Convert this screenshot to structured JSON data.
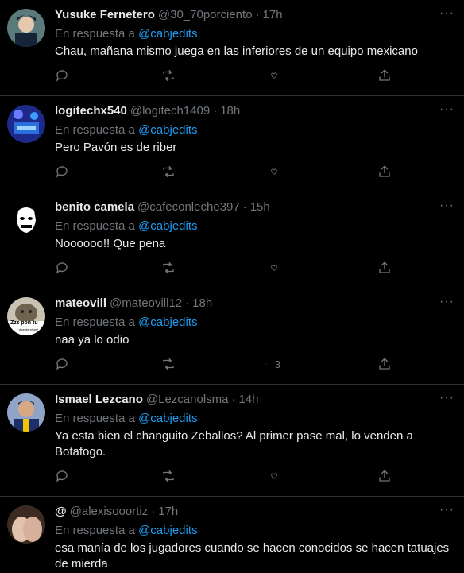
{
  "reply_prefix": "En respuesta a",
  "tweets": [
    {
      "name": "Yusuke Fernetero",
      "handle": "@30_70porciento",
      "time": "17h",
      "mention": "@cabjedits",
      "text": "Chau, mañana mismo juega en las inferiores de un equipo mexicano",
      "likes": ""
    },
    {
      "name": "logitechx540",
      "handle": "@logitech1409",
      "time": "18h",
      "mention": "@cabjedits",
      "text": "Pero Pavón es de riber",
      "likes": ""
    },
    {
      "name": "benito camela",
      "handle": "@cafeconleche397",
      "time": "15h",
      "mention": "@cabjedits",
      "text": "Noooooo!! Que pena",
      "likes": ""
    },
    {
      "name": "mateovill",
      "handle": "@mateovill12",
      "time": "18h",
      "mention": "@cabjedits",
      "text": "naa ya lo odio",
      "likes": "3"
    },
    {
      "name": "Ismael Lezcano",
      "handle": "@Lezcanolsma",
      "time": "14h",
      "mention": "@cabjedits",
      "text": "Ya esta bien el changuito Zeballos? Al primer pase mal, lo venden a Botafogo.",
      "likes": ""
    },
    {
      "name": "@",
      "handle": "@alexisooortiz",
      "time": "17h",
      "mention": "@cabjedits",
      "text": "esa manía de los jugadores cuando se hacen conocidos se hacen tatuajes de mierda",
      "likes": ""
    }
  ],
  "avatar_text": {
    "mateovill": "Zzz pon tu",
    "mateovill_sub": "* dice de show*"
  },
  "dot": "·",
  "more": "···"
}
